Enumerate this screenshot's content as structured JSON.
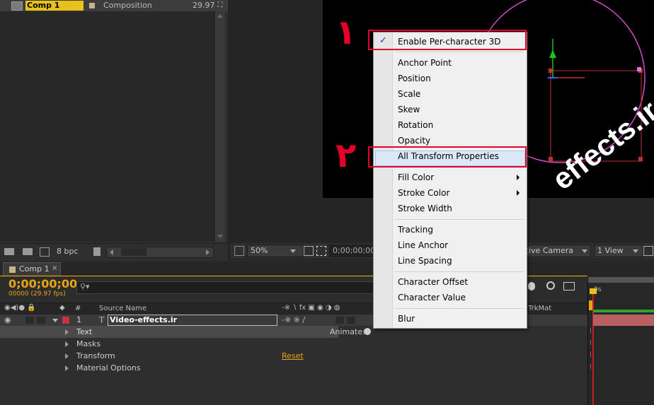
{
  "project_panel": {
    "comp_name": "Comp 1",
    "comp_type": "Composition",
    "comp_fps": "29.97",
    "bpc": "8 bpc"
  },
  "viewer": {
    "zoom": "50%",
    "timecode": "0;00;00;00",
    "camera": "Active Camera",
    "view": "1 View",
    "canvas_text": "effects.ir",
    "annotation_1": "١",
    "annotation_2": "٢"
  },
  "timeline": {
    "tab_label": "Comp 1",
    "timecode": "0;00;00;00",
    "frame_info": "00000 (29.97 fps)",
    "search_placeholder": "",
    "col_number": "#",
    "col_source_name": "Source Name",
    "col_trkmat": "TrkMat",
    "ruler_label": "0s",
    "layer": {
      "number": "1",
      "name": "Video-effects.ir"
    },
    "properties": [
      "Text",
      "Masks",
      "Transform",
      "Material Options"
    ],
    "animate_label": "Animate:",
    "reset_label": "Reset"
  },
  "context_menu": {
    "items": [
      {
        "label": "Enable Per-character 3D",
        "checked": true
      },
      {
        "label": "Anchor Point"
      },
      {
        "label": "Position"
      },
      {
        "label": "Scale"
      },
      {
        "label": "Skew"
      },
      {
        "label": "Rotation"
      },
      {
        "label": "Opacity"
      },
      {
        "label": "All Transform Properties",
        "highlighted": true
      },
      {
        "label": "Fill Color",
        "submenu": true
      },
      {
        "label": "Stroke Color",
        "submenu": true
      },
      {
        "label": "Stroke Width"
      },
      {
        "label": "Tracking"
      },
      {
        "label": "Line Anchor"
      },
      {
        "label": "Line Spacing"
      },
      {
        "label": "Character Offset"
      },
      {
        "label": "Character Value"
      },
      {
        "label": "Blur"
      }
    ]
  },
  "colors": {
    "accent_timecode": "#e8a317",
    "annotation_red": "#e4002b",
    "path_magenta": "#d04cc4",
    "layer_label_red": "#c8323a"
  }
}
